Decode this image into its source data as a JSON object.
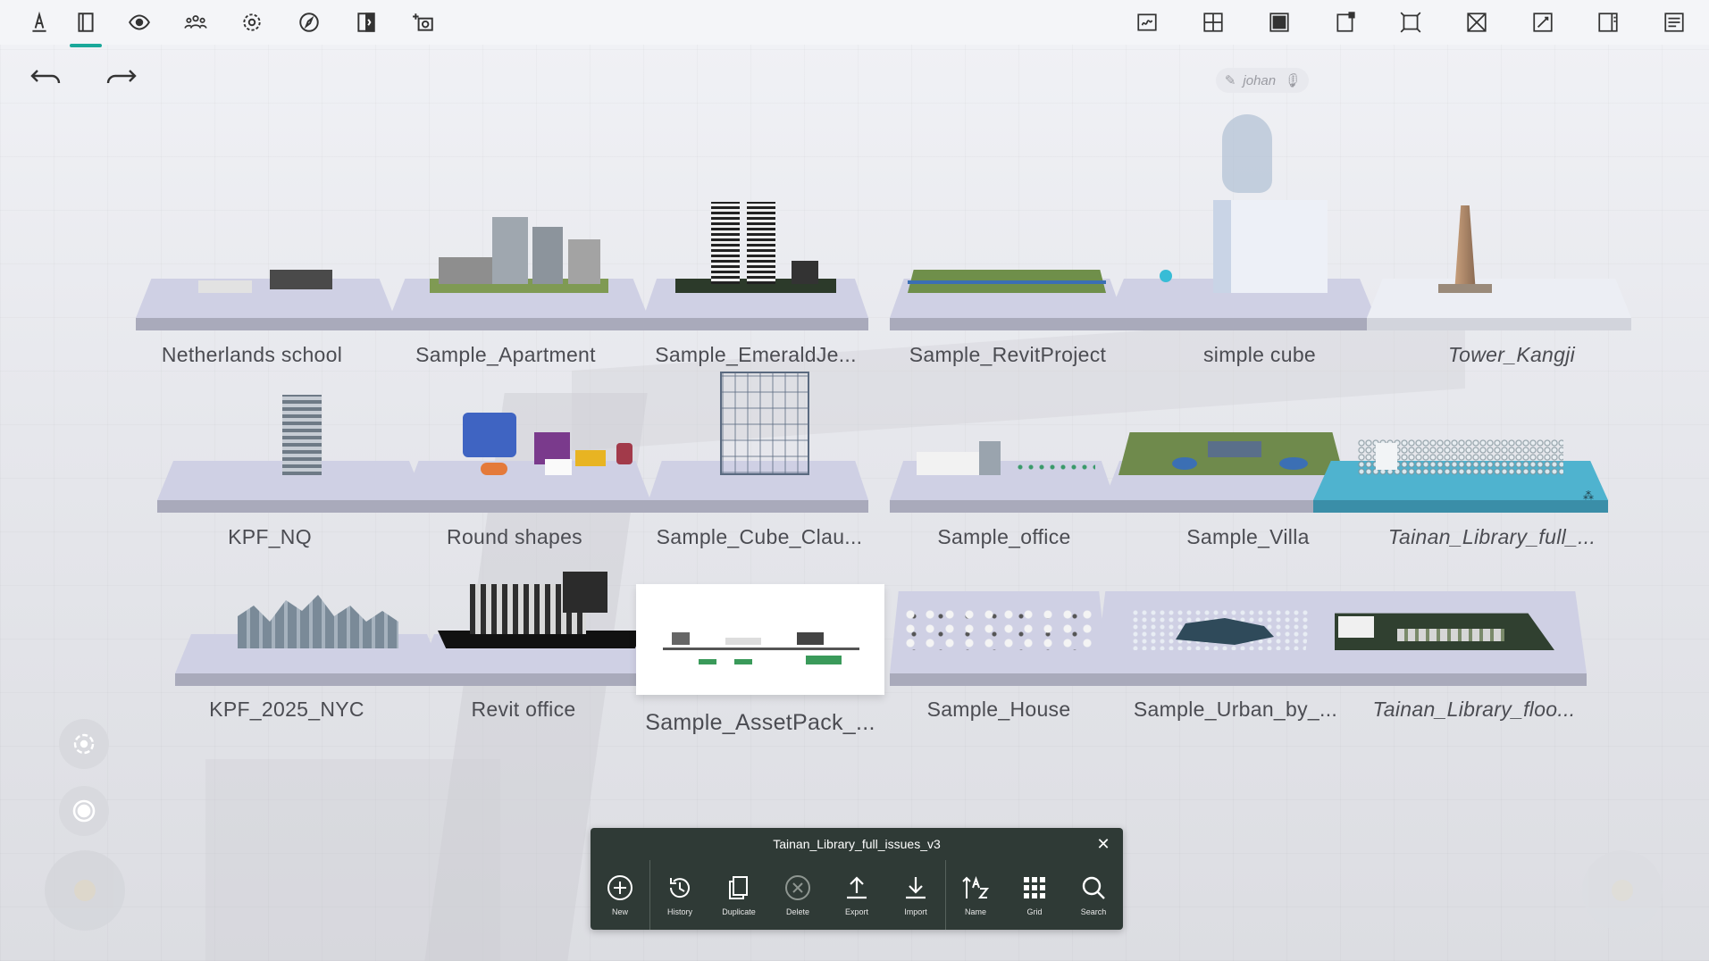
{
  "toolbar_left": [
    {
      "icon": "pen-icon"
    },
    {
      "icon": "panel-icon"
    },
    {
      "icon": "eye-icon"
    },
    {
      "icon": "people-icon"
    },
    {
      "icon": "gear-icon"
    },
    {
      "icon": "compass-icon"
    },
    {
      "icon": "split-view-icon"
    },
    {
      "icon": "camera-add-icon"
    }
  ],
  "toolbar_right": [
    {
      "icon": "sketch-frame-icon"
    },
    {
      "icon": "grid-add-icon"
    },
    {
      "icon": "solid-view-icon"
    },
    {
      "icon": "frame-corner-icon"
    },
    {
      "icon": "expand-frame-icon"
    },
    {
      "icon": "close-frame-icon"
    },
    {
      "icon": "edit-frame-icon"
    },
    {
      "icon": "side-panel-icon"
    },
    {
      "icon": "list-panel-icon"
    }
  ],
  "user": {
    "name": "johan"
  },
  "projects_row1": [
    {
      "label": "Netherlands school",
      "italic": false
    },
    {
      "label": "Sample_Apartment",
      "italic": false
    },
    {
      "label": "Sample_EmeraldJe...",
      "italic": false
    },
    {
      "label": "Sample_RevitProject",
      "italic": false
    },
    {
      "label": "simple cube",
      "italic": false
    },
    {
      "label": "Tower_Kangji",
      "italic": true
    }
  ],
  "projects_row2": [
    {
      "label": "KPF_NQ",
      "italic": false
    },
    {
      "label": "Round shapes",
      "italic": false
    },
    {
      "label": "Sample_Cube_Clau...",
      "italic": false
    },
    {
      "label": "Sample_office",
      "italic": false
    },
    {
      "label": "Sample_Villa",
      "italic": false
    },
    {
      "label": "Tainan_Library_full_...",
      "italic": true
    }
  ],
  "projects_row3": [
    {
      "label": "KPF_2025_NYC",
      "italic": false
    },
    {
      "label": "Revit office",
      "italic": false
    },
    {
      "label": "Sample_AssetPack_...",
      "italic": false
    },
    {
      "label": "Sample_House",
      "italic": false
    },
    {
      "label": "Sample_Urban_by_...",
      "italic": false
    },
    {
      "label": "Tainan_Library_floo...",
      "italic": true
    }
  ],
  "panel": {
    "title": "Tainan_Library_full_issues_v3",
    "tools": [
      {
        "label": "New",
        "icon": "plus-circle-icon"
      },
      {
        "label": "History",
        "icon": "history-icon"
      },
      {
        "label": "Duplicate",
        "icon": "duplicate-icon"
      },
      {
        "label": "Delete",
        "icon": "delete-icon"
      },
      {
        "label": "Export",
        "icon": "export-icon"
      },
      {
        "label": "Import",
        "icon": "import-icon"
      },
      {
        "label": "Name",
        "icon": "sort-name-icon"
      },
      {
        "label": "Grid",
        "icon": "grid-icon"
      },
      {
        "label": "Search",
        "icon": "search-icon"
      }
    ]
  },
  "colors": {
    "accent": "#1aa89a",
    "panel": "#2f3a36",
    "highlight_tile": "#4fb3cf"
  }
}
